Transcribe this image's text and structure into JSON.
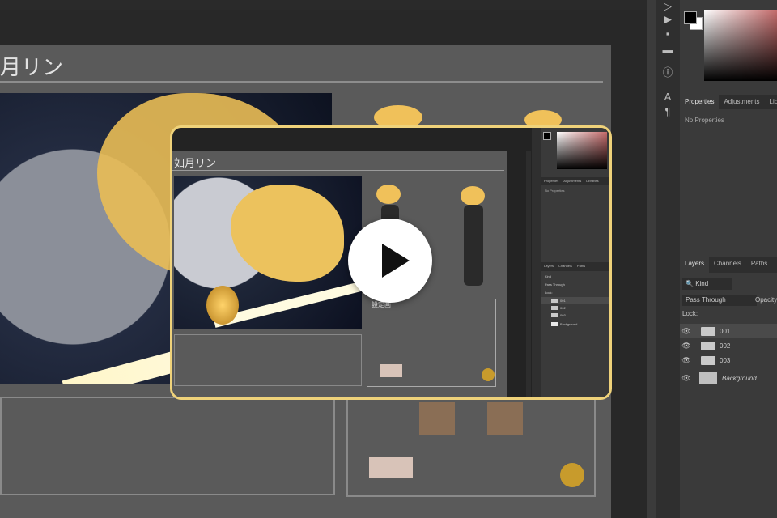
{
  "document": {
    "title": "月リン",
    "overlay_title": "如月リン",
    "ref_sheet_label": "設定画"
  },
  "properties_panel": {
    "tabs": [
      "Properties",
      "Adjustments",
      "Libraries"
    ],
    "empty_text": "No Properties"
  },
  "layers_panel": {
    "tabs": [
      "Layers",
      "Channels",
      "Paths"
    ],
    "kind_filter": "Kind",
    "blend_mode": "Pass Through",
    "opacity_label": "Opacity",
    "lock_label": "Lock:",
    "layers": [
      {
        "name": "001",
        "type": "folder"
      },
      {
        "name": "002",
        "type": "folder"
      },
      {
        "name": "003",
        "type": "folder"
      },
      {
        "name": "Background",
        "type": "image"
      }
    ]
  },
  "icons": {
    "play": "play-icon",
    "eye": "eye-icon",
    "folder": "folder-icon"
  },
  "colors": {
    "overlay_border": "#efd27a",
    "play_button": "#ffffff"
  }
}
